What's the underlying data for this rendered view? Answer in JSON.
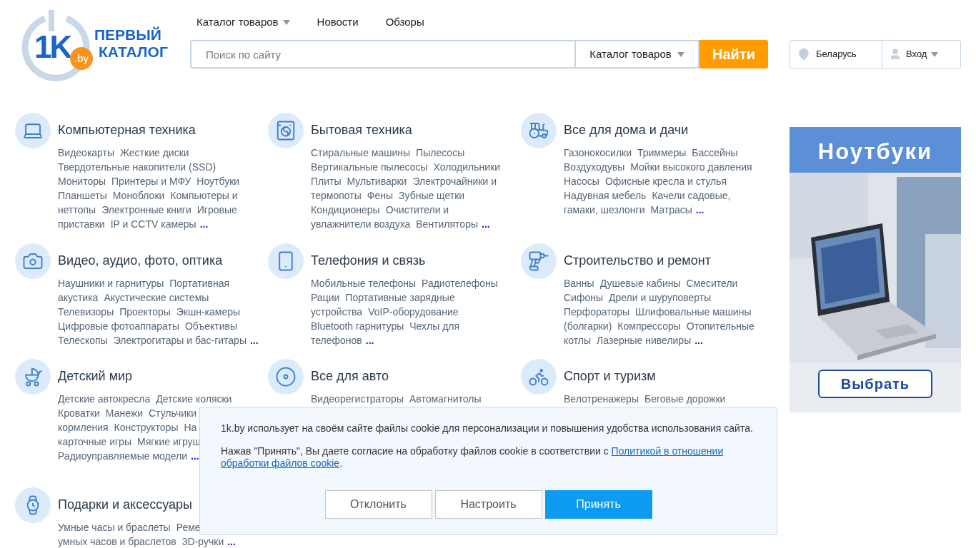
{
  "logo": {
    "mark": "1K",
    "badge": ".by",
    "line1": "ПЕРВЫЙ",
    "line2": "КАТАЛОГ"
  },
  "nav": [
    {
      "label": "Каталог товаров",
      "dropdown": true
    },
    {
      "label": "Новости",
      "dropdown": false
    },
    {
      "label": "Обзоры",
      "dropdown": false
    }
  ],
  "search": {
    "placeholder": "Поиск по сайту",
    "scope": "Каталог товаров",
    "button": "Найти"
  },
  "region": "Беларусь",
  "login": "Вход",
  "categories": [
    {
      "title": "Компьютерная техника",
      "lines": [
        [
          "Видеокарты",
          "Жесткие диски"
        ],
        [
          "Твердотельные накопители (SSD)"
        ],
        [
          "Мониторы",
          "Принтеры и МФУ",
          "Ноутбуки"
        ],
        [
          "Планшеты",
          "Моноблоки",
          "Компьютеры и"
        ],
        [
          "неттопы",
          "Электронные книги",
          "Игровые"
        ],
        [
          "приставки",
          "IP и CCTV камеры"
        ]
      ],
      "more": "..."
    },
    {
      "title": "Бытовая техника",
      "lines": [
        [
          "Стиральные машины",
          "Пылесосы"
        ],
        [
          "Вертикальные пылесосы",
          "Холодильники"
        ],
        [
          "Плиты",
          "Мультиварки",
          "Электрочайники и"
        ],
        [
          "термопоты",
          "Фены",
          "Зубные щетки"
        ],
        [
          "Кондиционеры",
          "Очистители и"
        ],
        [
          "увлажнители воздуха",
          "Вентиляторы"
        ]
      ],
      "more": "..."
    },
    {
      "title": "Все для дома и дачи",
      "lines": [
        [
          "Газонокосилки",
          "Триммеры",
          "Бассейны"
        ],
        [
          "Воздуходувы",
          "Мойки высокого давления"
        ],
        [
          "Насосы",
          "Офисные кресла и стулья"
        ],
        [
          "Надувная мебель",
          "Качели садовые,"
        ],
        [
          "гамаки, шезлонги",
          "Матрасы"
        ]
      ],
      "more": "..."
    },
    {
      "title": "Видео, аудио, фото, оптика",
      "lines": [
        [
          "Наушники и гарнитуры",
          "Портативная"
        ],
        [
          "акустика",
          "Акустические системы"
        ],
        [
          "Телевизоры",
          "Проекторы",
          "Экшн-камеры"
        ],
        [
          "Цифровые фотоаппараты",
          "Объективы"
        ],
        [
          "Телескопы",
          "Электрогитары и бас-гитары"
        ]
      ],
      "more": "..."
    },
    {
      "title": "Телефония и связь",
      "lines": [
        [
          "Мобильные телефоны",
          "Радиотелефоны"
        ],
        [
          "Рации",
          "Портативные зарядные"
        ],
        [
          "устройства",
          "VoIP-оборудование"
        ],
        [
          "Bluetooth гарнитуры",
          "Чехлы для"
        ],
        [
          "телефонов"
        ]
      ],
      "more": "..."
    },
    {
      "title": "Строительство и ремонт",
      "lines": [
        [
          "Ванны",
          "Душевые кабины",
          "Смесители"
        ],
        [
          "Сифоны",
          "Дрели и шуруповерты"
        ],
        [
          "Перфораторы",
          "Шлифовальные машины"
        ],
        [
          "(болгарки)",
          "Компрессоры",
          "Отопительные"
        ],
        [
          "котлы",
          "Лазерные нивелиры"
        ]
      ],
      "more": "..."
    },
    {
      "title": "Детский мир",
      "lines": [
        [
          "Детские автокресла",
          "Детские коляски"
        ],
        [
          "Кроватки",
          "Манежи",
          "Стульчики"
        ],
        [
          "кормления",
          "Конструкторы",
          "На"
        ],
        [
          "карточные игры",
          "Мягкие игруш"
        ],
        [
          "Радиоуправляемые модели"
        ]
      ],
      "more": "..."
    },
    {
      "title": "Все для авто",
      "lines": [
        [
          "Видеорегистраторы",
          "Автомагнитолы"
        ]
      ]
    },
    {
      "title": "Спорт и туризм",
      "lines": [
        [
          "Велотренажеры",
          "Беговые дорожки"
        ]
      ]
    },
    {
      "title": "Подарки и аксессуары",
      "lines": [
        [
          "Умные часы и браслеты",
          "Реме"
        ],
        [
          "умных часов и браслетов",
          "3D-ручки"
        ]
      ],
      "more": "..."
    }
  ],
  "ad": {
    "title": "Ноутбуки",
    "button": "Выбрать"
  },
  "cookie": {
    "text": "1k.by использует на своём сайте файлы cookie для персонализации и повышения удобства использования сайта.",
    "consent": "Нажав \"Принять\", Вы даете согласие на обработку файлов cookie в соответствии с",
    "link_line1": "Политикой в отношении",
    "link_line2": "обработки файлов cookie",
    "end": ".",
    "buttons": [
      {
        "label": "Отклонить",
        "primary": false
      },
      {
        "label": "Настроить",
        "primary": false
      },
      {
        "label": "Принять",
        "primary": true
      }
    ]
  }
}
